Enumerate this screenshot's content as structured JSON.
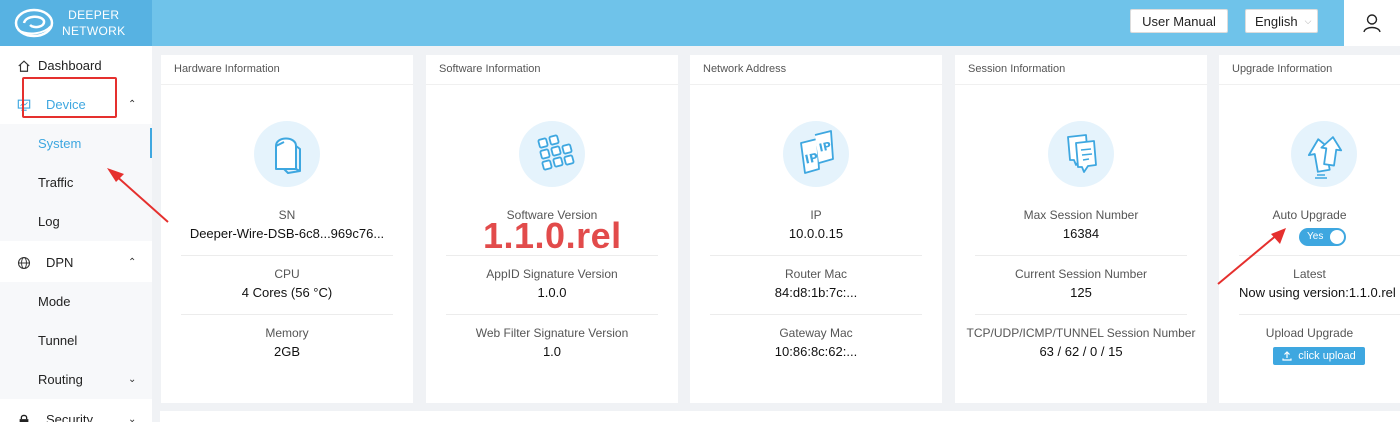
{
  "brand": {
    "line1": "DEEPER",
    "line2": "NETWORK"
  },
  "header": {
    "manual_label": "User Manual",
    "language": "English"
  },
  "sidebar": {
    "items": [
      {
        "label": "Dashboard"
      },
      {
        "label": "Device"
      },
      {
        "label": "System"
      },
      {
        "label": "Traffic"
      },
      {
        "label": "Log"
      },
      {
        "label": "DPN"
      },
      {
        "label": "Mode"
      },
      {
        "label": "Tunnel"
      },
      {
        "label": "Routing"
      },
      {
        "label": "Security"
      }
    ]
  },
  "cards": {
    "hardware": {
      "title": "Hardware Information",
      "rows": [
        {
          "label": "SN",
          "value": "Deeper-Wire-DSB-6c8...969c76..."
        },
        {
          "label": "CPU",
          "value": "4 Cores (56 °C)"
        },
        {
          "label": "Memory",
          "value": "2GB"
        }
      ]
    },
    "software": {
      "title": "Software Information",
      "rows": [
        {
          "label": "Software Version",
          "value": ""
        },
        {
          "label": "AppID Signature Version",
          "value": "1.0.0"
        },
        {
          "label": "Web Filter Signature Version",
          "value": "1.0"
        }
      ],
      "highlight": "1.1.0.rel"
    },
    "network": {
      "title": "Network Address",
      "rows": [
        {
          "label": "IP",
          "value": "10.0.0.15"
        },
        {
          "label": "Router Mac",
          "value": "84:d8:1b:7c:..."
        },
        {
          "label": "Gateway Mac",
          "value": "10:86:8c:62:..."
        }
      ]
    },
    "session": {
      "title": "Session Information",
      "rows": [
        {
          "label": "Max Session Number",
          "value": "16384"
        },
        {
          "label": "Current Session Number",
          "value": "125"
        },
        {
          "label": "TCP/UDP/ICMP/TUNNEL Session Number",
          "value": "63 / 62 / 0 / 15"
        }
      ]
    },
    "upgrade": {
      "title": "Upgrade Information",
      "auto_label": "Auto Upgrade",
      "toggle_label": "Yes",
      "latest_label": "Latest",
      "latest_value": "Now using version:1.1.0.rel",
      "upload_label": "Upload Upgrade",
      "upload_button": "click upload"
    }
  },
  "colors": {
    "accent": "#3ea7e0",
    "header": "#6fc3ea",
    "annotation": "#e5302e"
  }
}
